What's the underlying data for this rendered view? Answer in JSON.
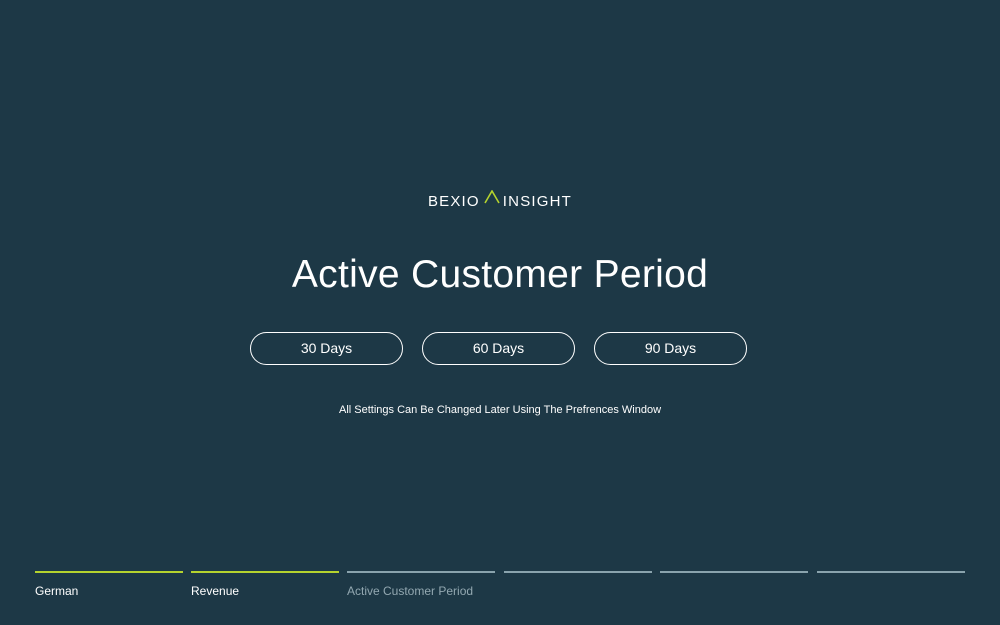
{
  "brand": {
    "left": "BEXIO",
    "right": "INSIGHT",
    "accent_color": "#b5d32e",
    "icon": "chevron-up-logo-mark"
  },
  "title": "Active Customer Period",
  "options": [
    {
      "label": "30 Days"
    },
    {
      "label": "60 Days"
    },
    {
      "label": "90 Days"
    }
  ],
  "hint": "All Settings Can Be Changed Later Using The Prefrences Window",
  "steps": [
    {
      "label": "German",
      "state": "done"
    },
    {
      "label": "Revenue",
      "state": "done"
    },
    {
      "label": "Active Customer Period",
      "state": "current"
    },
    {
      "label": "",
      "state": "pending"
    },
    {
      "label": "",
      "state": "pending"
    },
    {
      "label": "",
      "state": "pending"
    }
  ],
  "colors": {
    "background": "#1d3846",
    "progress_done": "#b5d32e",
    "progress_pending": "#8aa3ad"
  }
}
